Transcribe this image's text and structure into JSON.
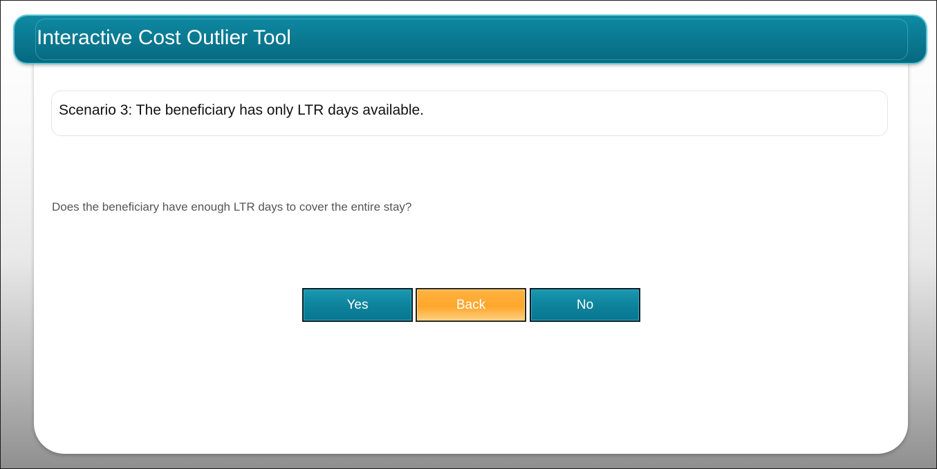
{
  "header": {
    "title": "Interactive Cost Outlier Tool"
  },
  "scenario": {
    "text": "Scenario 3: The beneficiary has only LTR days available."
  },
  "question": {
    "text": "Does the beneficiary have enough LTR days to cover the entire stay?"
  },
  "buttons": {
    "yes_label": "Yes",
    "back_label": "Back",
    "no_label": "No"
  },
  "colors": {
    "accent": "#0a7991",
    "back_button": "#ffa62c"
  }
}
